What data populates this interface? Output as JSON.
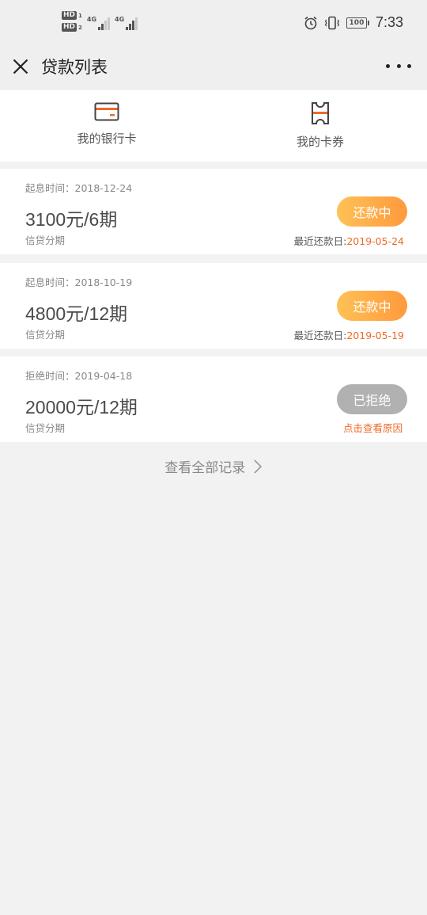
{
  "status_bar": {
    "sim1": "HD",
    "sim1_index": "1",
    "sim2": "HD",
    "sim2_index": "2",
    "net1": "4G",
    "net2": "4G",
    "battery": "100",
    "time": "7:33",
    "icons": [
      "alarm-icon",
      "vibrate-icon",
      "battery-icon",
      "signal-icon"
    ]
  },
  "header": {
    "title": "贷款列表",
    "icons": [
      "close-icon",
      "more-icon"
    ]
  },
  "shortcuts": [
    {
      "label": "我的银行卡",
      "icon": "bank-card-icon"
    },
    {
      "label": "我的卡券",
      "icon": "coupon-icon"
    }
  ],
  "loans": [
    {
      "date": "起息时间：2018-12-24",
      "amount": "3100元/6期",
      "type": "信贷分期",
      "status": "还款中",
      "note_label": "最近还款日:",
      "note_date": "2019-05-24"
    },
    {
      "date": "起息时间：2018-10-19",
      "amount": "4800元/12期",
      "type": "信贷分期",
      "status": "还款中",
      "note_label": "最近还款日:",
      "note_date": "2019-05-19"
    },
    {
      "date": "拒绝时间：2019-04-18",
      "amount": "20000元/12期",
      "type": "信贷分期",
      "status": "已拒绝",
      "reason_link": "点击查看原因"
    }
  ],
  "view_all": "查看全部记录",
  "colors": {
    "accent_orange": "#ef6a27",
    "button_gradient_start": "#ffc157",
    "button_gradient_end": "#ff9a3c",
    "rejected_gray": "#b1b1b1",
    "background": "#f2f2f2"
  }
}
